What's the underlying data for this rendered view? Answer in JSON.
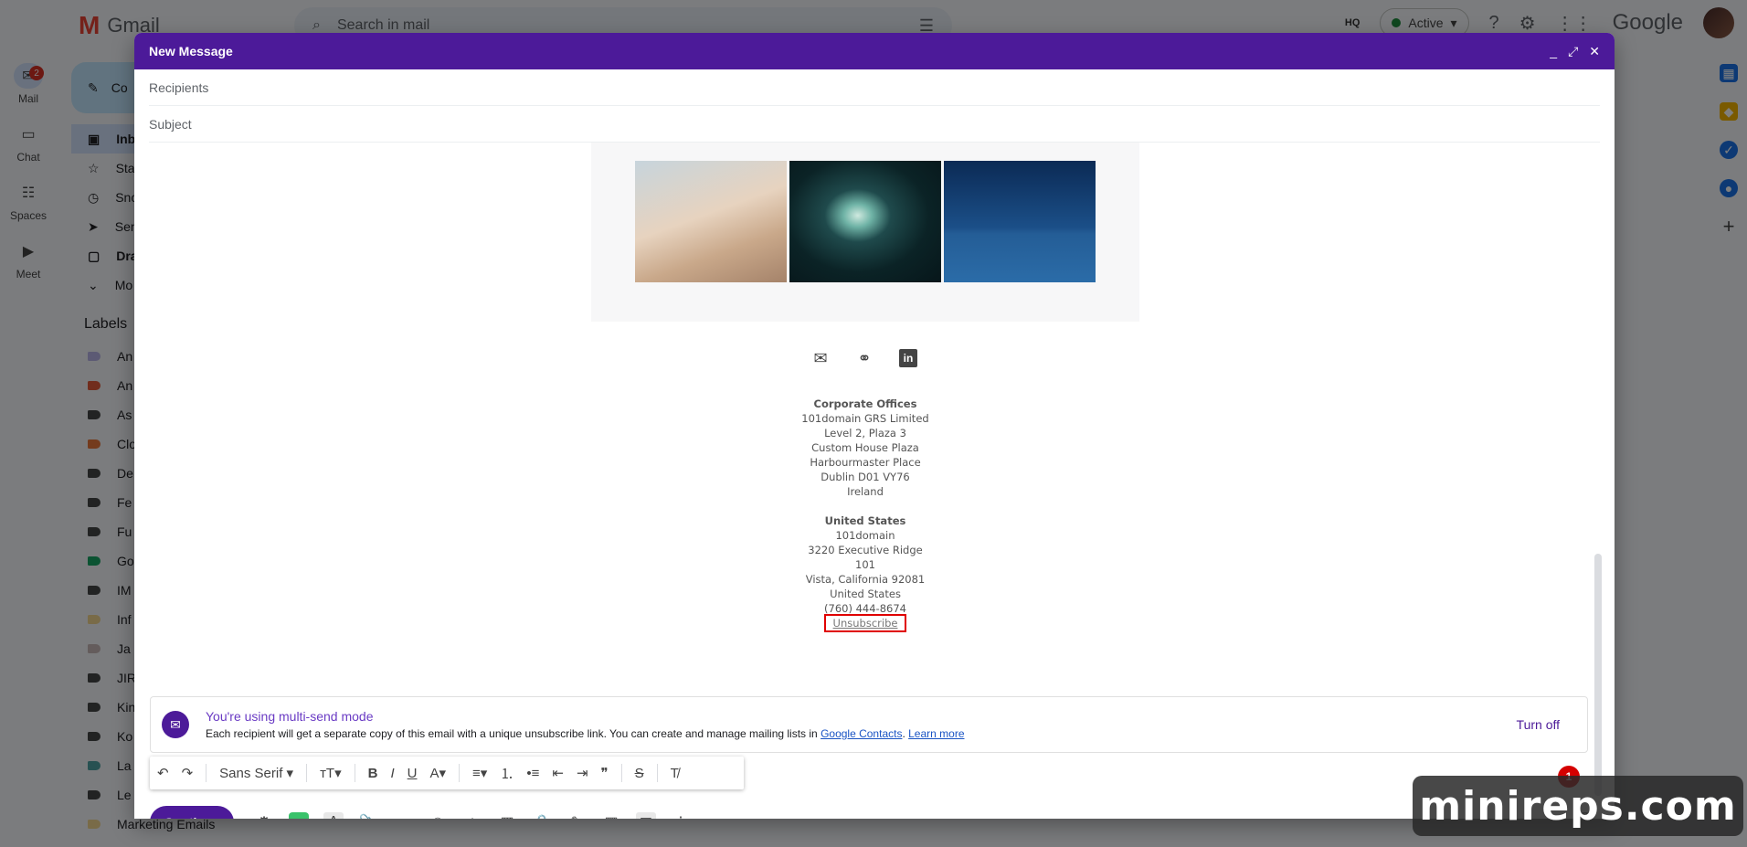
{
  "gmail": {
    "brand": "Gmail",
    "search_placeholder": "Search in mail",
    "status": "Active",
    "google": "Google",
    "clockin": "HQ"
  },
  "rail": [
    {
      "label": "Mail",
      "badge": "2"
    },
    {
      "label": "Chat"
    },
    {
      "label": "Spaces"
    },
    {
      "label": "Meet"
    }
  ],
  "nav": {
    "compose": "Co",
    "items": [
      "Inb",
      "Sta",
      "Sno",
      "Sen",
      "Dra",
      "Mo"
    ],
    "labels_heading": "Labels",
    "labels": [
      {
        "name": "An",
        "color": "#b9b4e8"
      },
      {
        "name": "An",
        "color": "#e25a3a"
      },
      {
        "name": "As",
        "color": "#444746"
      },
      {
        "name": "Clo",
        "color": "#e8763a"
      },
      {
        "name": "De",
        "color": "#444746"
      },
      {
        "name": "Fe",
        "color": "#444746"
      },
      {
        "name": "Fu",
        "color": "#444746"
      },
      {
        "name": "Go",
        "color": "#16a765"
      },
      {
        "name": "IM",
        "color": "#444746"
      },
      {
        "name": "Inf",
        "color": "#f2d790"
      },
      {
        "name": "Ja",
        "color": "#c9b9b9"
      },
      {
        "name": "JIR",
        "color": "#444746"
      },
      {
        "name": "Kin",
        "color": "#444746"
      },
      {
        "name": "Ko",
        "color": "#444746"
      },
      {
        "name": "La",
        "color": "#4fa3a5"
      },
      {
        "name": "Le",
        "color": "#444746"
      },
      {
        "name": "Marketing Emails",
        "color": "#f2d790"
      }
    ]
  },
  "compose": {
    "title": "New Message",
    "recipients_placeholder": "Recipients",
    "subject_placeholder": "Subject",
    "address": {
      "corporate_heading": "Corporate Offices",
      "corporate_lines": [
        "101domain GRS Limited",
        "Level 2, Plaza 3",
        "Custom House Plaza",
        "Harbourmaster Place",
        "Dublin D01 VY76",
        "Ireland"
      ],
      "us_heading": "United States",
      "us_lines": [
        "101domain",
        "3220 Executive Ridge",
        "101",
        "Vista, California 92081",
        "United States",
        "(760) 444-8674"
      ],
      "unsubscribe": "Unsubscribe"
    },
    "notice": {
      "title": "You're using multi-send mode",
      "text": "Each recipient will get a separate copy of this email with a unique unsubscribe link. You can create and manage mailing lists in ",
      "link_contacts": "Google Contacts",
      "link_learn": "Learn more",
      "turn_off": "Turn off"
    },
    "format": {
      "font": "Sans Serif"
    },
    "badge_count": "1",
    "continue": "Continue"
  },
  "watermark": "minireps.com",
  "colors": {
    "compose_header": "#4c1a99",
    "unsubscribe_highlight": "#e00000"
  }
}
